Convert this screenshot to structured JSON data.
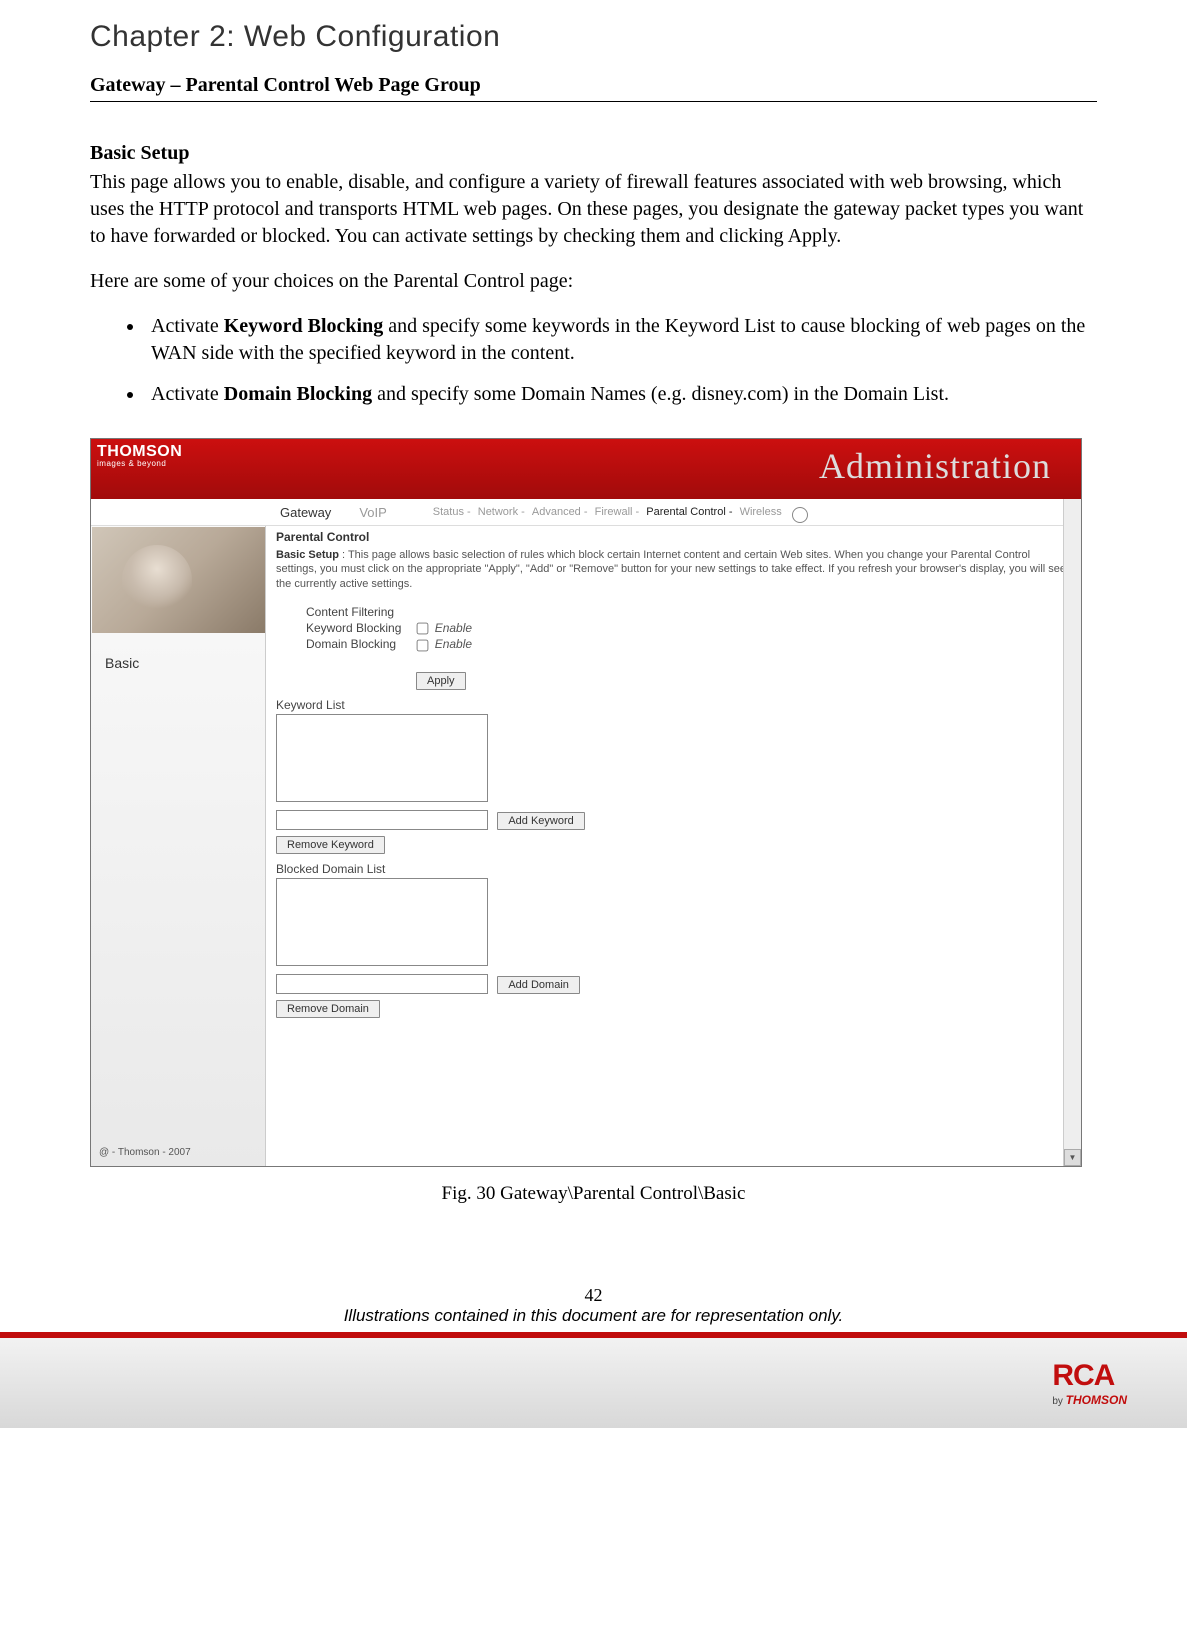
{
  "chapter_title": "Chapter 2: Web Configuration",
  "section_title": "Gateway – Parental Control Web Page Group",
  "sub_heading": "Basic Setup",
  "intro_paragraph": "This page allows you to enable, disable, and configure a variety of firewall features associated with web browsing, which uses the HTTP protocol and transports HTML web pages. On these pages, you designate the gateway packet types you want to have forwarded or blocked. You can activate settings by checking them and clicking Apply.",
  "choices_intro": "Here are some of your choices on the Parental Control page:",
  "bullet1_pre": "Activate ",
  "bullet1_bold": "Keyword Blocking",
  "bullet1_post": " and specify some keywords in the Keyword List to cause blocking of web pages on the WAN side with the specified keyword in the content.",
  "bullet2_pre": "Activate ",
  "bullet2_bold": "Domain Blocking",
  "bullet2_post": " and specify some Domain Names (e.g. disney.com) in the Domain List.",
  "screenshot": {
    "brand": "THOMSON",
    "brand_sub": "images & beyond",
    "banner_right": "Administration",
    "tabs_main": [
      "Gateway",
      "VoIP"
    ],
    "tabs_sub": [
      "Status -",
      "Network -",
      "Advanced -",
      "Firewall -",
      "Parental Control -",
      "Wireless"
    ],
    "tabs_active_index": 4,
    "sidebar_item": "Basic",
    "sidebar_footer": "@ - Thomson - 2007",
    "panel_title": "Parental Control",
    "panel_desc_bold": "Basic Setup",
    "panel_desc": " : This page allows basic selection of rules which block certain Internet content and certain Web sites. When you change your Parental Control settings, you must click on the appropriate \"Apply\", \"Add\" or \"Remove\" button for your new settings to take effect. If you refresh your browser's display, you will see the currently active settings.",
    "content_filtering_label": "Content Filtering",
    "keyword_blocking_label": "Keyword Blocking",
    "domain_blocking_label": "Domain Blocking",
    "enable_label": "Enable",
    "apply_btn": "Apply",
    "keyword_list_label": "Keyword List",
    "add_keyword_btn": "Add Keyword",
    "remove_keyword_btn": "Remove Keyword",
    "blocked_domain_label": "Blocked Domain List",
    "add_domain_btn": "Add Domain",
    "remove_domain_btn": "Remove Domain"
  },
  "figure_caption": "Fig. 30 Gateway\\Parental Control\\Basic",
  "page_number": "42",
  "footer_note": "Illustrations contained in this document are for representation only.",
  "brand_footer": {
    "logo": "RCA",
    "by": "by",
    "company": "THOMSON"
  }
}
